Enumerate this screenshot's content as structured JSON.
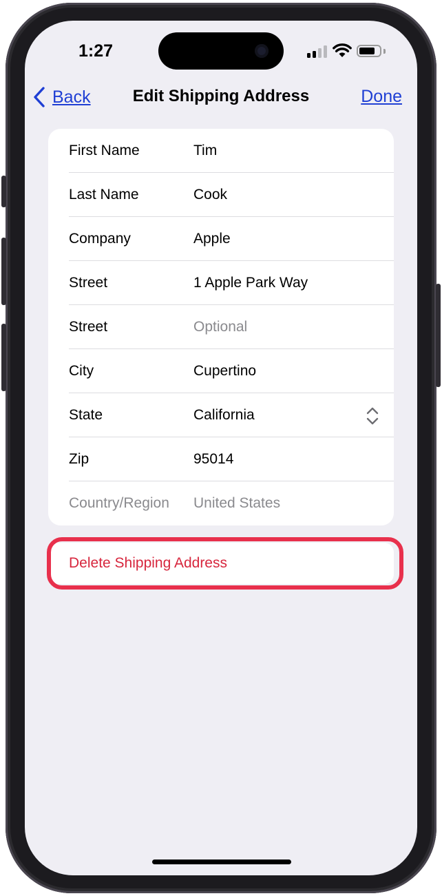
{
  "status_bar": {
    "time": "1:27"
  },
  "nav": {
    "back_label": "Back",
    "title": "Edit Shipping Address",
    "done_label": "Done"
  },
  "form": {
    "rows": [
      {
        "label": "First Name",
        "value": "Tim"
      },
      {
        "label": "Last Name",
        "value": "Cook"
      },
      {
        "label": "Company",
        "value": "Apple"
      },
      {
        "label": "Street",
        "value": "1 Apple Park Way"
      },
      {
        "label": "Street",
        "placeholder": "Optional"
      },
      {
        "label": "City",
        "value": "Cupertino"
      },
      {
        "label": "State",
        "value": "California"
      },
      {
        "label": "Zip",
        "value": "95014"
      },
      {
        "label": "Country/Region",
        "value": "United States"
      }
    ]
  },
  "delete_button": {
    "label": "Delete Shipping Address",
    "color": "#d7263d"
  },
  "colors": {
    "accent": "#1f3fd4",
    "highlight": "#e8304c",
    "background": "#efeef4"
  },
  "icons": [
    "chevron-left-icon",
    "signal-icon",
    "wifi-icon",
    "battery-icon",
    "up-down-chevron-icon"
  ]
}
